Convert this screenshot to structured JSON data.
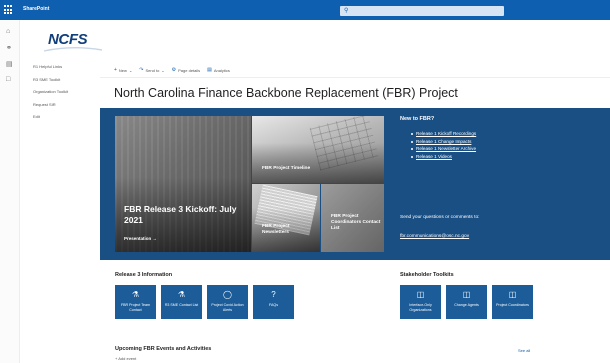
{
  "suitebar": {
    "app_name": "SharePoint",
    "search_icon": "search-icon"
  },
  "rail": {
    "icons": [
      "home-icon",
      "globe-icon",
      "news-icon",
      "page-icon"
    ]
  },
  "logo": {
    "text": "NCFS"
  },
  "leftnav": {
    "items": [
      {
        "label": "R1 Helpful Links"
      },
      {
        "label": "R3 SME Toolkit"
      },
      {
        "label": "Organization Toolkit"
      },
      {
        "label": "Request SIR"
      },
      {
        "label": "Edit"
      }
    ]
  },
  "command_bar": {
    "items": [
      {
        "label": "New",
        "icon": "plus-icon"
      },
      {
        "label": "Send to",
        "icon": "share-icon"
      },
      {
        "label": "Page details",
        "icon": "gear-icon"
      },
      {
        "label": "Analytics",
        "icon": "chart-icon"
      }
    ]
  },
  "page": {
    "title": "North Carolina Finance Backbone Replacement (FBR) Project"
  },
  "hero": {
    "main": {
      "title": "FBR Release 3 Kickoff: July 2021",
      "cta": "Presentation →"
    },
    "timeline": {
      "title": "FBR Project Timeline"
    },
    "newsletters": {
      "title": "FBR Project Newsletters"
    },
    "coordinators": {
      "title": "FBR Project Coordinators Contact List"
    }
  },
  "fbr_panel": {
    "heading": "New to FBR?",
    "links": [
      {
        "label": "Release 1 Kickoff Recordings"
      },
      {
        "label": "Release 1 Change Impacts"
      },
      {
        "label": "Release 1 Newsletter Archive"
      },
      {
        "label": "Release 1 Videos"
      }
    ],
    "question": "Send your questions or comments to:",
    "email": "fbr.communications@osc.nc.gov"
  },
  "release3": {
    "heading": "Release 3 Information",
    "tiles": [
      {
        "label": "FBR Project Team Contact",
        "icon": "people-icon"
      },
      {
        "label": "R3 SME Contact List",
        "icon": "people-icon"
      },
      {
        "label": "Project Covid Action Alerts",
        "icon": "shield-icon"
      },
      {
        "label": "FAQs",
        "icon": "question-icon"
      }
    ]
  },
  "toolkits": {
    "heading": "Stakeholder Toolkits",
    "tiles": [
      {
        "label": "Interface-Only Organizations",
        "icon": "toolbox-icon"
      },
      {
        "label": "Change Agents",
        "icon": "toolbox-icon"
      },
      {
        "label": "Project Coordinators",
        "icon": "toolbox-icon"
      }
    ]
  },
  "events": {
    "heading": "Upcoming FBR Events and Activities",
    "see_all": "See all",
    "add_event": "Add event"
  },
  "colors": {
    "suite_blue": "#0f5fb0",
    "band_blue": "#1a4f84",
    "tile_blue": "#1b5c99"
  }
}
